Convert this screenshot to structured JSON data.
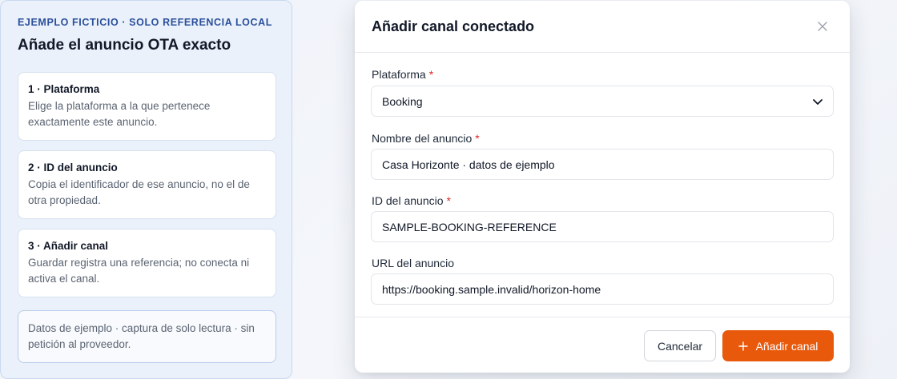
{
  "guide": {
    "eyebrow": "EJEMPLO FICTICIO · SOLO REFERENCIA LOCAL",
    "title": "Añade el anuncio OTA exacto",
    "steps": [
      {
        "title": "1 · Plataforma",
        "text": "Elige la plataforma a la que pertenece exactamente este anuncio."
      },
      {
        "title": "2 · ID del anuncio",
        "text": "Copia el identificador de ese anuncio, no el de otra propiedad."
      },
      {
        "title": "3 · Añadir canal",
        "text": "Guardar registra una referencia; no conecta ni activa el canal."
      }
    ],
    "note": "Datos de ejemplo · captura de solo lectura · sin petición al proveedor."
  },
  "modal": {
    "title": "Añadir canal conectado",
    "close_icon": "close-icon",
    "fields": {
      "platform": {
        "label": "Plataforma",
        "required_mark": "*",
        "value": "Booking"
      },
      "listing_name": {
        "label": "Nombre del anuncio",
        "required_mark": "*",
        "value": "Casa Horizonte · datos de ejemplo"
      },
      "listing_id": {
        "label": "ID del anuncio",
        "required_mark": "*",
        "value": "SAMPLE-BOOKING-REFERENCE"
      },
      "listing_url": {
        "label": "URL del anuncio",
        "value": "https://booking.sample.invalid/horizon-home"
      }
    },
    "buttons": {
      "cancel": "Cancelar",
      "add": "Añadir canal",
      "add_icon": "plus-icon"
    }
  },
  "colors": {
    "accent": "#e8590c",
    "eyebrow": "#2b4f9a",
    "required": "#dc2626",
    "panel_bg": "#eaf1fb"
  }
}
